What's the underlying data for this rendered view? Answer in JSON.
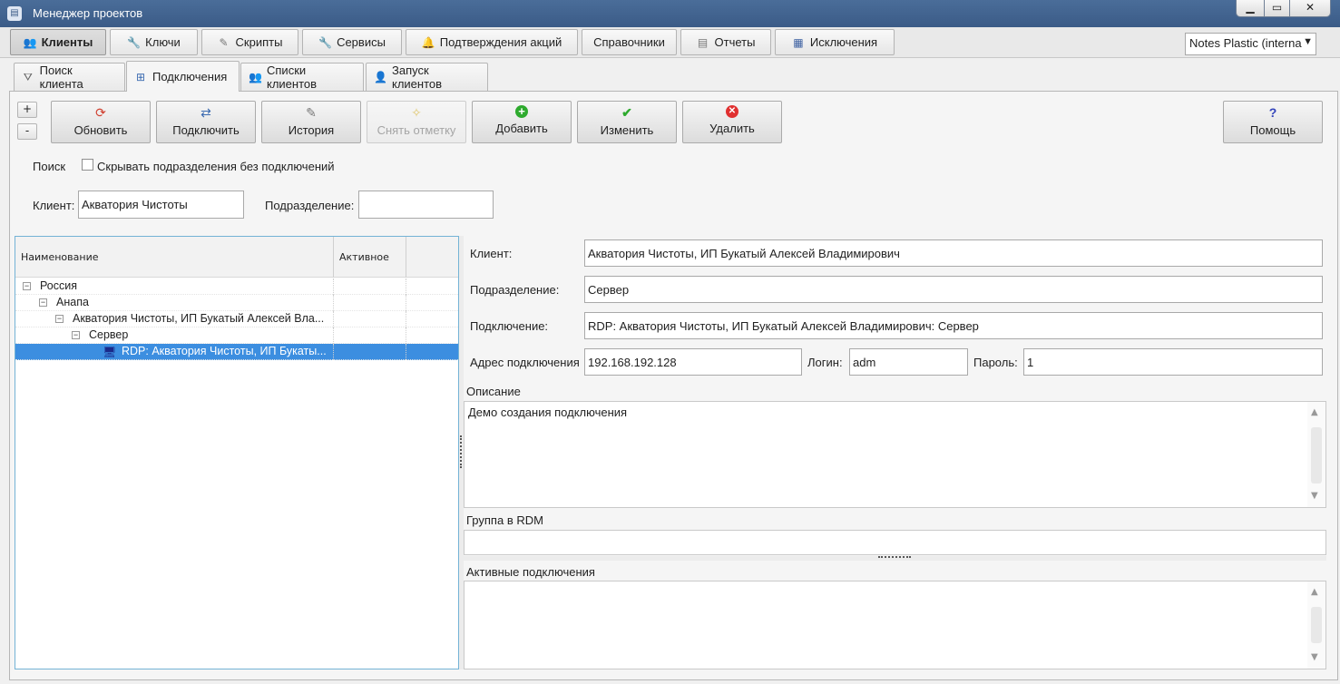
{
  "window": {
    "title": "Менеджер проектов",
    "min": "▁",
    "max": "▭",
    "close": "✕"
  },
  "main_tabs": [
    {
      "label": "Клиенты",
      "icon": "users-icon"
    },
    {
      "label": "Ключи",
      "icon": "wrench-icon"
    },
    {
      "label": "Скрипты",
      "icon": "script-icon"
    },
    {
      "label": "Сервисы",
      "icon": "wrench-icon"
    },
    {
      "label": "Подтверждения акций",
      "icon": "bell-icon"
    },
    {
      "label": "Справочники",
      "icon": ""
    },
    {
      "label": "Отчеты",
      "icon": "report-icon"
    },
    {
      "label": "Исключения",
      "icon": "grid-icon"
    }
  ],
  "project_select": {
    "value": "Notes Plastic (interna"
  },
  "sub_tabs": [
    {
      "label": "Поиск клиента",
      "icon": "filter-icon"
    },
    {
      "label": "Подключения",
      "icon": "network-icon"
    },
    {
      "label": "Списки клиентов",
      "icon": "users-icon"
    },
    {
      "label": "Запуск клиентов",
      "icon": "user-add-icon"
    }
  ],
  "toolbar": {
    "plus": "+",
    "minus": "-",
    "refresh": "Обновить",
    "connect": "Подключить",
    "history": "История",
    "unmark": "Снять отметку",
    "add": "Добавить",
    "edit": "Изменить",
    "delete": "Удалить",
    "help": "Помощь",
    "icons": {
      "refresh": "⟳",
      "connect": "⇄",
      "history": "✎",
      "unmark": "✧",
      "add": "+",
      "edit": "✔",
      "delete": "✕",
      "help": "?"
    },
    "colors": {
      "add": "#2eaa2e",
      "edit": "#2eaa2e",
      "delete": "#e03030",
      "help": "#3344bb",
      "refresh": "#d04030"
    }
  },
  "search": {
    "label": "Поиск",
    "hide_checkbox_label": "Скрывать подразделения без подключений",
    "client_label": "Клиент:",
    "client_value": "Акватория Чистоты",
    "division_label": "Подразделение:",
    "division_value": ""
  },
  "tree": {
    "columns": [
      "Наименование",
      "Активное"
    ],
    "rows": [
      {
        "text": "Россия",
        "level": 0,
        "expander": "−"
      },
      {
        "text": "Анапа",
        "level": 1,
        "expander": "−"
      },
      {
        "text": "Акватория Чистоты, ИП Букатый Алексей Вла...",
        "level": 2,
        "expander": "−"
      },
      {
        "text": "Сервер",
        "level": 3,
        "expander": "−"
      },
      {
        "text": "RDP: Акватория Чистоты, ИП Букаты...",
        "level": 4,
        "expander": "",
        "selected": true
      }
    ]
  },
  "details": {
    "client_label": "Клиент:",
    "client_value": "Акватория Чистоты, ИП Букатый Алексей Владимирович",
    "division_label": "Подразделение:",
    "division_value": "Сервер",
    "connection_label": "Подключение:",
    "connection_value": "RDP: Акватория Чистоты, ИП Букатый Алексей Владимирович: Сервер",
    "address_label": "Адрес подключения",
    "address_value": "192.168.192.128",
    "login_label": "Логин:",
    "login_value": "adm",
    "password_label": "Пароль:",
    "password_value": "1",
    "description_label": "Описание",
    "description_value": "Демо создания подключения",
    "rdm_group_label": "Группа в RDM",
    "rdm_group_value": "",
    "active_connections_label": "Активные подключения"
  }
}
